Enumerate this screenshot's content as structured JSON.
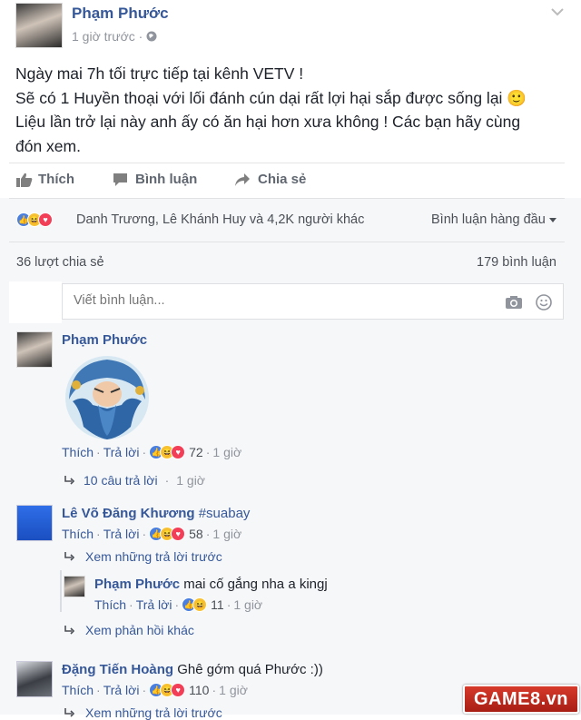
{
  "post": {
    "author": "Phạm Phước",
    "time": "1 giờ trước",
    "text_lines": [
      "Ngày mai 7h tối trực tiếp tại kênh VETV !",
      "Sẽ có 1 Huyền thoại với lối đánh cún dại rất lợi hại sắp được sống lại 🙂",
      "Liệu lần trở lại này anh ấy có ăn hại hơn xưa không ! Các bạn hãy cùng",
      "đón xem."
    ]
  },
  "actions": {
    "like": "Thích",
    "comment": "Bình luận",
    "share": "Chia sẻ"
  },
  "reactions_summary": {
    "names": "Danh Trương, Lê Khánh Huy và 4,2K người khác",
    "sort_label": "Bình luận hàng đầu"
  },
  "counts": {
    "shares": "36 lượt chia sẻ",
    "comments": "179 bình luận"
  },
  "comment_input": {
    "placeholder": "Viết bình luận..."
  },
  "comments": [
    {
      "author": "Phạm Phước",
      "text": "",
      "like": "Thích",
      "reply": "Trả lời",
      "reactions": "72",
      "time": "1 giờ",
      "replies_link": "10 câu trả lời",
      "replies_time": "1 giờ"
    },
    {
      "author": "Lê Võ Đăng Khương",
      "text": "#suabay",
      "like": "Thích",
      "reply": {
        "author": "Phạm Phước",
        "text": "mai cố gắng nha a kingj",
        "like": "Thích",
        "reply_label": "Trả lời",
        "reactions": "11",
        "time": "1 giờ"
      },
      "reactions": "58",
      "time": "1 giờ",
      "prev_replies": "Xem những trả lời trước",
      "more_replies": "Xem phản hồi khác"
    },
    {
      "author": "Đặng Tiến Hoàng",
      "text": "Ghê gớm quá Phước :))",
      "like": "Thích",
      "reply": "Trả lời",
      "reactions": "110",
      "time": "1 giờ",
      "prev_replies": "Xem những trả lời trước"
    }
  ],
  "watermark": "GAME8.vn"
}
